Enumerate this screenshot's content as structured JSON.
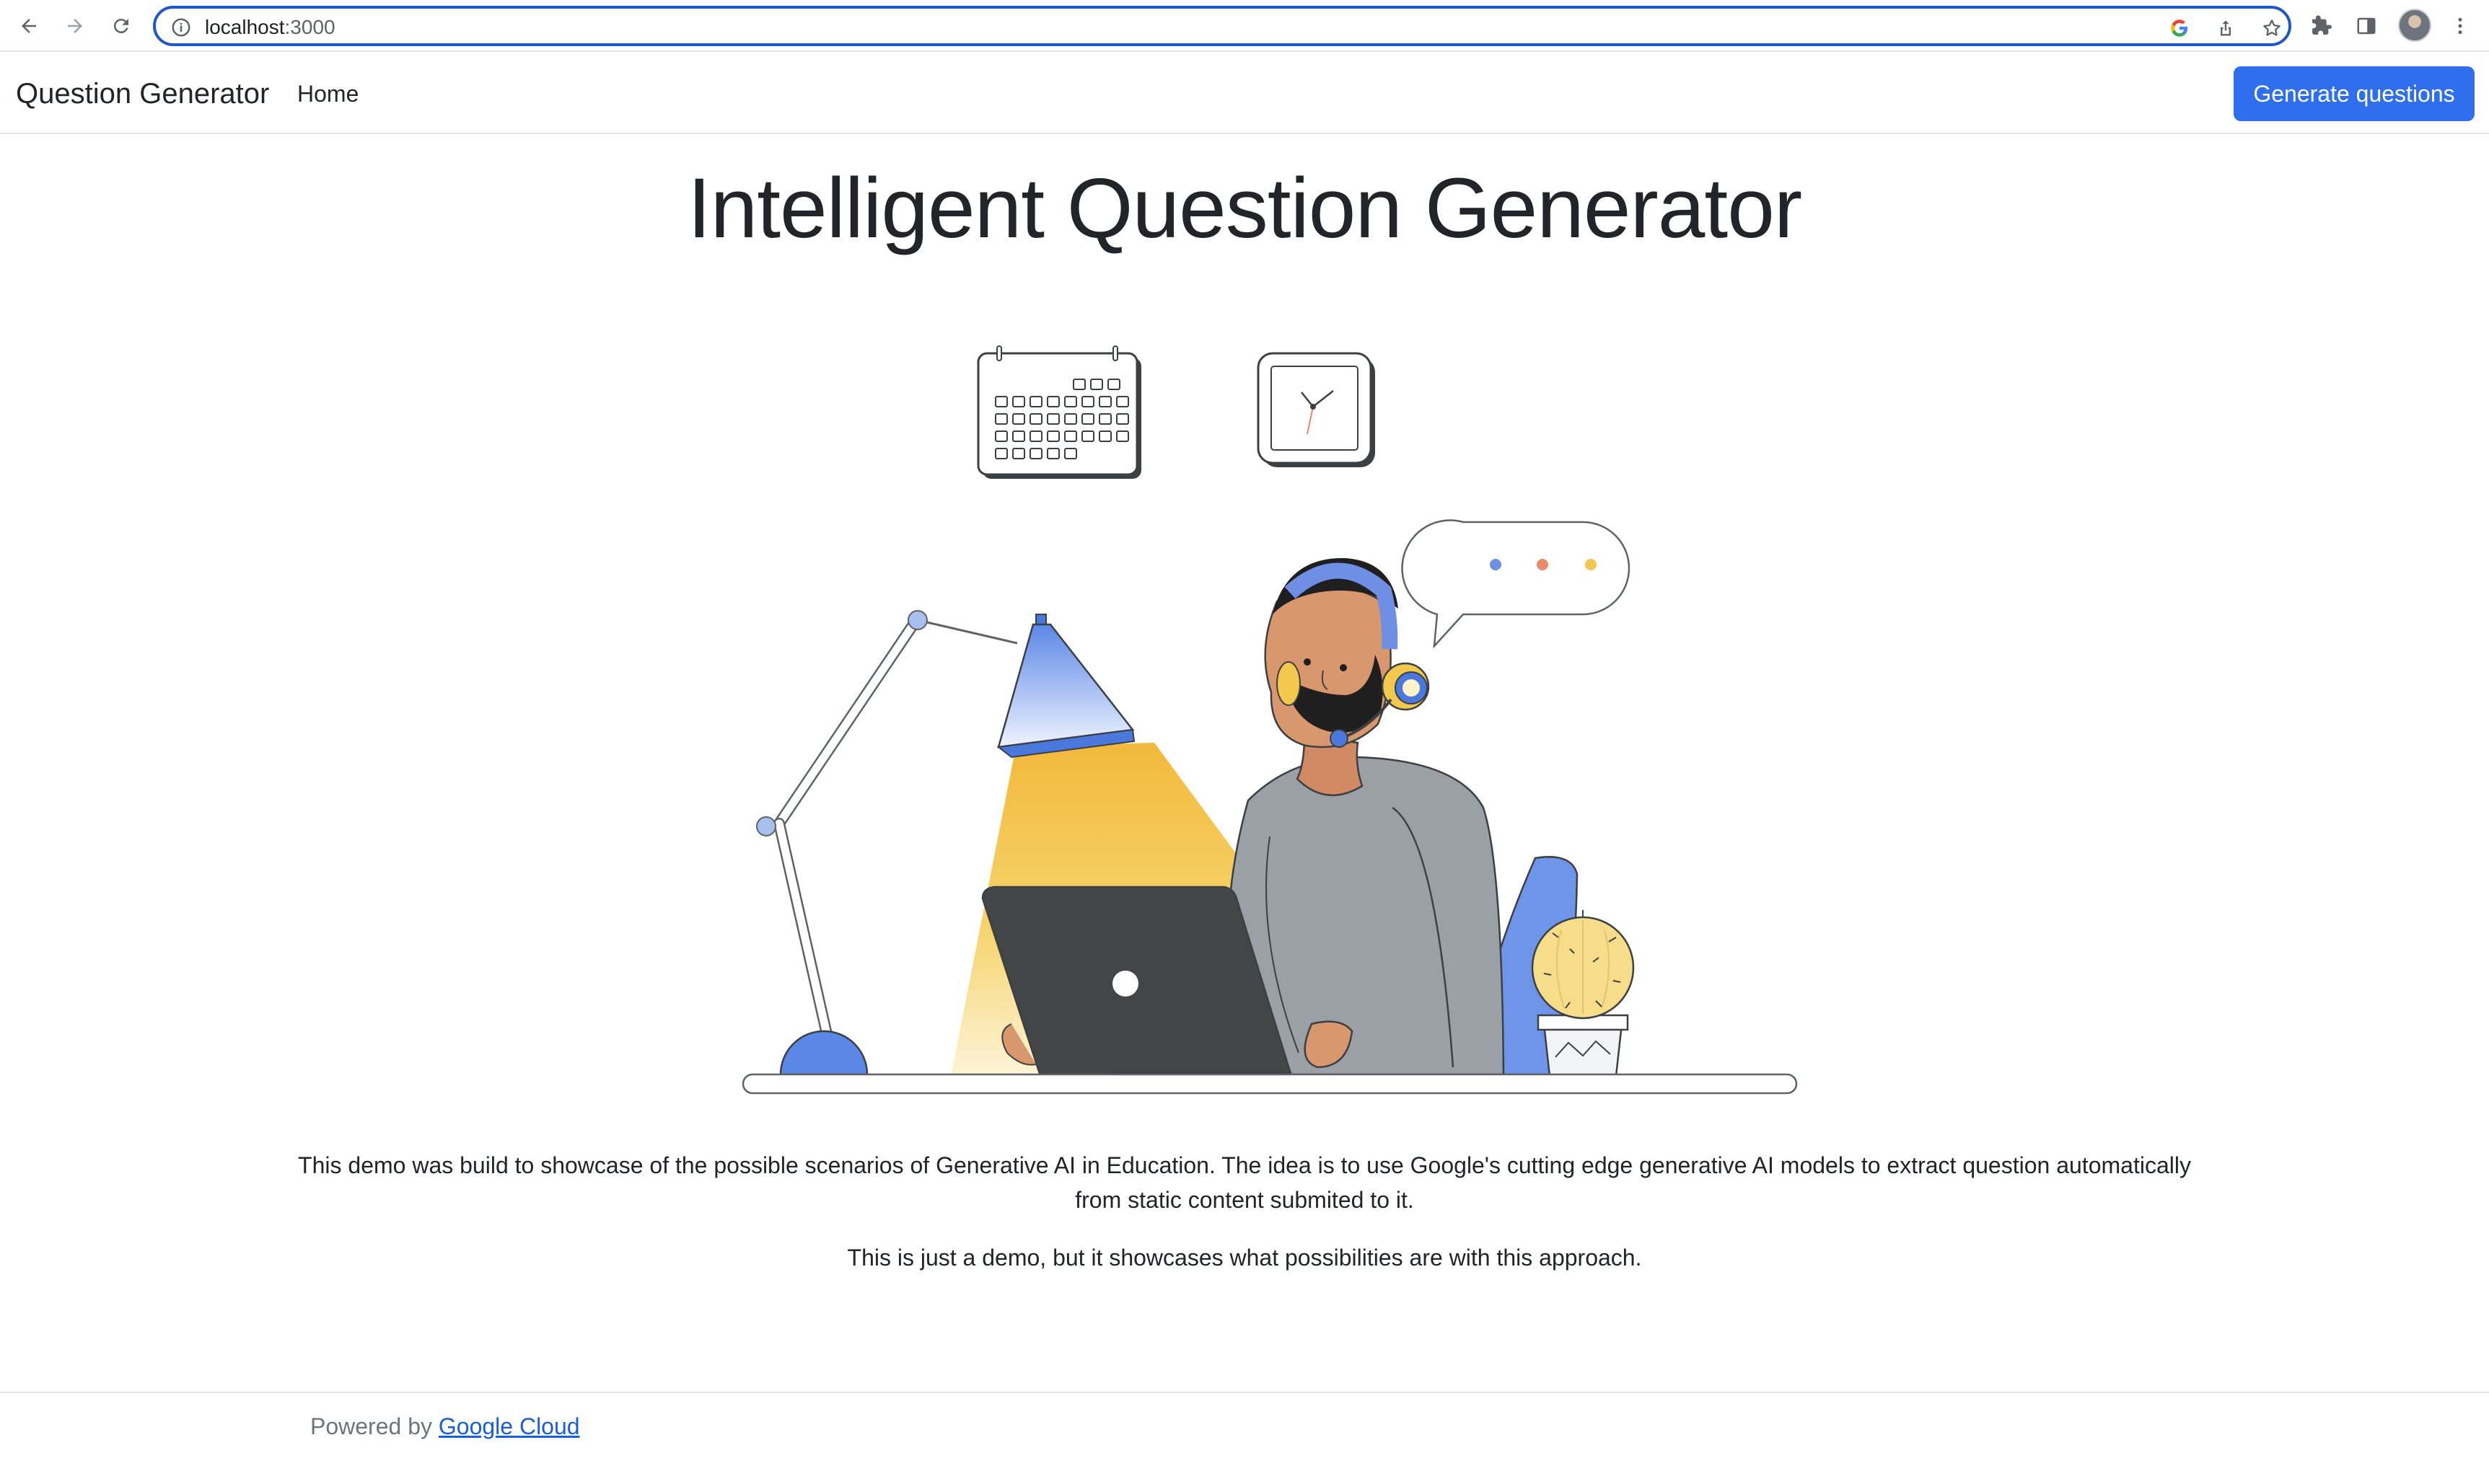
{
  "browser": {
    "url_host": "localhost",
    "url_port": ":3000",
    "icons": [
      "back-icon",
      "forward-icon",
      "reload-icon",
      "site-info-icon",
      "google-icon",
      "share-icon",
      "bookmark-star-icon",
      "extensions-icon",
      "side-panel-icon",
      "profile-avatar",
      "more-menu-icon"
    ]
  },
  "navbar": {
    "brand": "Question Generator",
    "home_label": "Home",
    "cta_label": "Generate questions"
  },
  "main": {
    "title": "Intelligent Question Generator",
    "description_1": "This demo was build to showcase of the possible scenarios of Generative AI in Education. The idea is to use Google's cutting edge generative AI models to extract question automatically from static content submited to it.",
    "description_2": "This is just a demo, but it showcases what possibilities are with this approach."
  },
  "footer": {
    "prefix": "Powered by ",
    "link_label": "Google Cloud"
  },
  "colors": {
    "primary": "#2f6fed",
    "omnibox_border": "#1f57c9",
    "text": "#212529",
    "muted": "#6c757d",
    "link": "#1a5ed8"
  }
}
